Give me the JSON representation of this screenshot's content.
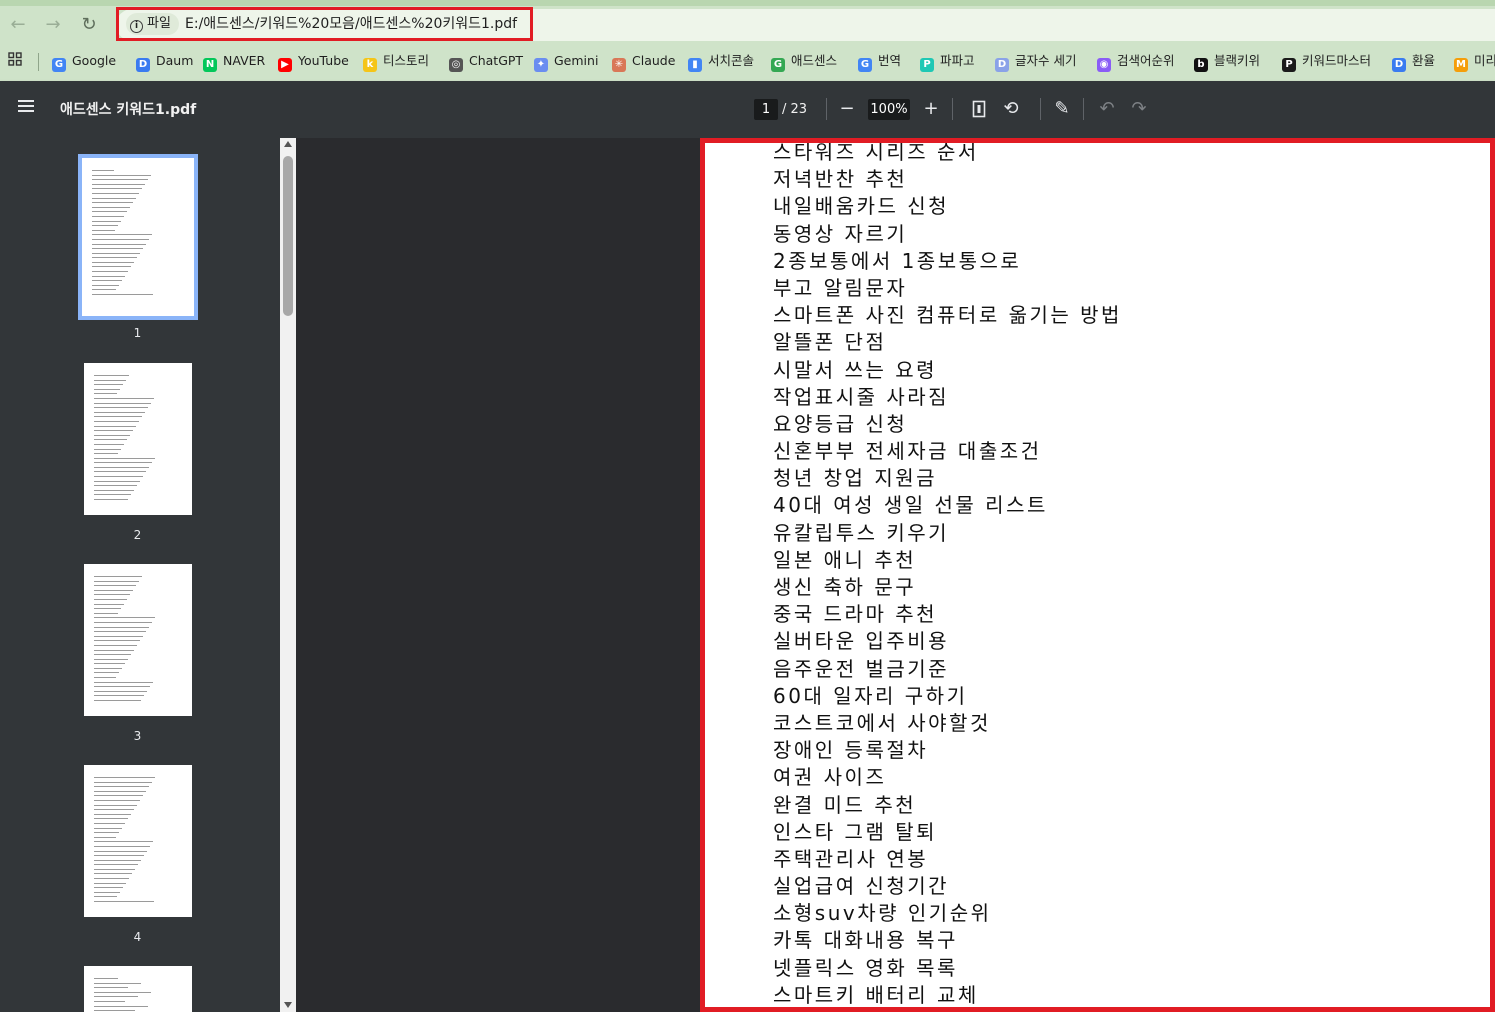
{
  "browser": {
    "site_info": "파일",
    "url": "E:/애드센스/키워드%20모음/애드센스%20키워드1.pdf",
    "bookmarks": [
      {
        "label": "Google",
        "color": "#4285f4",
        "glyph": "G"
      },
      {
        "label": "Daum",
        "color": "#3a7bf0",
        "glyph": "D"
      },
      {
        "label": "NAVER",
        "color": "#03c75a",
        "glyph": "N"
      },
      {
        "label": "YouTube",
        "color": "#ff0000",
        "glyph": "▶"
      },
      {
        "label": "티스토리",
        "color": "#f5c518",
        "glyph": "k"
      },
      {
        "label": "ChatGPT",
        "color": "#555555",
        "glyph": "◎"
      },
      {
        "label": "Gemini",
        "color": "#6a8df0",
        "glyph": "✦"
      },
      {
        "label": "Claude",
        "color": "#d97757",
        "glyph": "✳"
      },
      {
        "label": "서치콘솔",
        "color": "#4285f4",
        "glyph": "▮"
      },
      {
        "label": "애드센스",
        "color": "#34a853",
        "glyph": "G"
      },
      {
        "label": "번역",
        "color": "#4285f4",
        "glyph": "G"
      },
      {
        "label": "파파고",
        "color": "#1ec8b4",
        "glyph": "P"
      },
      {
        "label": "글자수 세기",
        "color": "#8aa2e8",
        "glyph": "D"
      },
      {
        "label": "검색어순위",
        "color": "#8a5cf6",
        "glyph": "◉"
      },
      {
        "label": "블랙키위",
        "color": "#111111",
        "glyph": "b"
      },
      {
        "label": "키워드마스터",
        "color": "#1a1a1a",
        "glyph": "P"
      },
      {
        "label": "환율",
        "color": "#3a7bf0",
        "glyph": "D"
      },
      {
        "label": "미리",
        "color": "#f59e0b",
        "glyph": "M"
      }
    ]
  },
  "pdf": {
    "title": "애드센스 키워드1.pdf",
    "page_current": "1",
    "page_total": "/ 23",
    "zoom": "100%",
    "thumbnails": [
      "1",
      "2",
      "3",
      "4"
    ],
    "keywords": [
      "스타워즈 시리즈 순서",
      "저녁반찬 추천",
      "내일배움카드 신청",
      "동영상 자르기",
      "2종보통에서 1종보통으로",
      "부고 알림문자",
      "스마트폰 사진 컴퓨터로 옮기는 방법",
      "알뜰폰 단점",
      "시말서 쓰는 요령",
      "작업표시줄 사라짐",
      "요양등급 신청",
      "신혼부부 전세자금 대출조건",
      "청년 창업 지원금",
      "40대 여성 생일 선물 리스트",
      "유칼립투스 키우기",
      "일본 애니 추천",
      "생신 축하 문구",
      "중국 드라마 추천",
      "실버타운 입주비용",
      "음주운전 벌금기준",
      "60대 일자리 구하기",
      "코스트코에서 사야할것",
      "장애인 등록절차",
      "여권 사이즈",
      "완결 미드 추천",
      "인스타 그램 탈퇴",
      "주택관리사 연봉",
      "실업급여 신청기간",
      "소형suv차량 인기순위",
      "카톡 대화내용 복구",
      "넷플릭스 영화 목록",
      "스마트키 배터리 교체"
    ]
  }
}
